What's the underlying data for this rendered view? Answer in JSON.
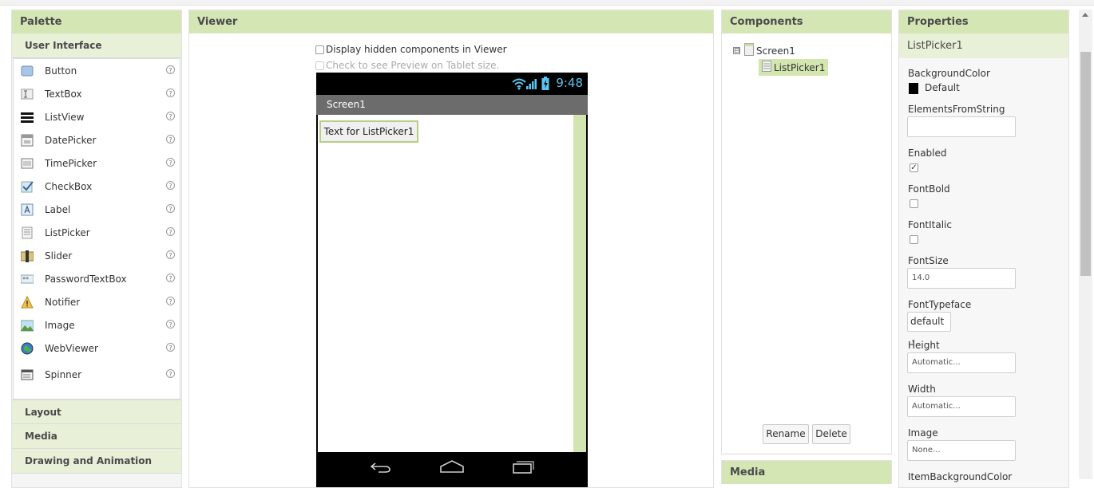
{
  "palette": {
    "title": "Palette",
    "category_open": "User Interface",
    "items": [
      {
        "label": "Button",
        "icon": "button-icon"
      },
      {
        "label": "TextBox",
        "icon": "textbox-icon"
      },
      {
        "label": "ListView",
        "icon": "listview-icon"
      },
      {
        "label": "DatePicker",
        "icon": "datepicker-icon"
      },
      {
        "label": "TimePicker",
        "icon": "timepicker-icon"
      },
      {
        "label": "CheckBox",
        "icon": "checkbox-icon"
      },
      {
        "label": "Label",
        "icon": "label-icon"
      },
      {
        "label": "ListPicker",
        "icon": "listpicker-icon"
      },
      {
        "label": "Slider",
        "icon": "slider-icon"
      },
      {
        "label": "PasswordTextBox",
        "icon": "passwordtextbox-icon"
      },
      {
        "label": "Notifier",
        "icon": "notifier-icon"
      },
      {
        "label": "Image",
        "icon": "image-icon"
      },
      {
        "label": "WebViewer",
        "icon": "webviewer-icon"
      },
      {
        "label": "Spinner",
        "icon": "spinner-icon"
      }
    ],
    "help_glyph": "?",
    "categories": [
      "Layout",
      "Media",
      "Drawing and Animation"
    ]
  },
  "viewer": {
    "title": "Viewer",
    "display_hidden_label": "Display hidden components in Viewer",
    "tablet_preview_label": "Check to see Preview on Tablet size.",
    "phone": {
      "time": "9:48",
      "screen_title": "Screen1",
      "listpicker_text": "Text for ListPicker1"
    }
  },
  "components": {
    "title": "Components",
    "tree_toggle": "⊟",
    "root": "Screen1",
    "child": "ListPicker1",
    "rename_label": "Rename",
    "delete_label": "Delete",
    "next_panel_title": "Media"
  },
  "properties": {
    "title": "Properties",
    "component_name": "ListPicker1",
    "background_color_label": "BackgroundColor",
    "background_color_value": "Default",
    "elements_from_string_label": "ElementsFromString",
    "elements_from_string_value": "",
    "enabled_label": "Enabled",
    "enabled_checked": true,
    "fontbold_label": "FontBold",
    "fontitalic_label": "FontItalic",
    "fontsize_label": "FontSize",
    "fontsize_value": "14.0",
    "fonttypeface_label": "FontTypeface",
    "fonttypeface_value": "default",
    "height_label": "Height",
    "height_value": "Automatic...",
    "width_label": "Width",
    "width_value": "Automatic...",
    "image_label": "Image",
    "image_value": "None...",
    "next_label": "ItemBackgroundColor"
  },
  "colors": {
    "header_green": "#d5e6b5",
    "selected_green": "#d3e6b0",
    "clock_blue": "#5cc6f0"
  }
}
